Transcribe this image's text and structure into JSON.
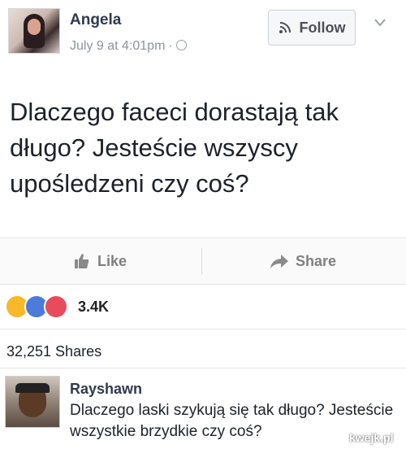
{
  "post": {
    "author": "Angela",
    "date": "July 9 at 4:01pm",
    "meta_separator": "·",
    "follow_label": "Follow",
    "text": "Dlaczego faceci dorastają tak długo? Jesteście wszyscy upośledzeni czy coś?"
  },
  "actions": {
    "like_label": "Like",
    "share_label": "Share"
  },
  "reactions": {
    "count": "3.4K",
    "types": [
      "haha-icon",
      "like-icon",
      "love-icon"
    ]
  },
  "shares": "32,251 Shares",
  "comment": {
    "author": "Rayshawn",
    "text": "Dlaczego laski szykują się tak długo? Jesteście wszystkie brzydkie czy coś?"
  },
  "watermark": "kwejk.pl",
  "colors": {
    "author": "#2f3a4f",
    "meta": "#8d949e",
    "action": "#7f7f7f",
    "like_reaction": "#4c7bd9",
    "love_reaction": "#e84c5c",
    "haha_reaction": "#f7b928"
  }
}
